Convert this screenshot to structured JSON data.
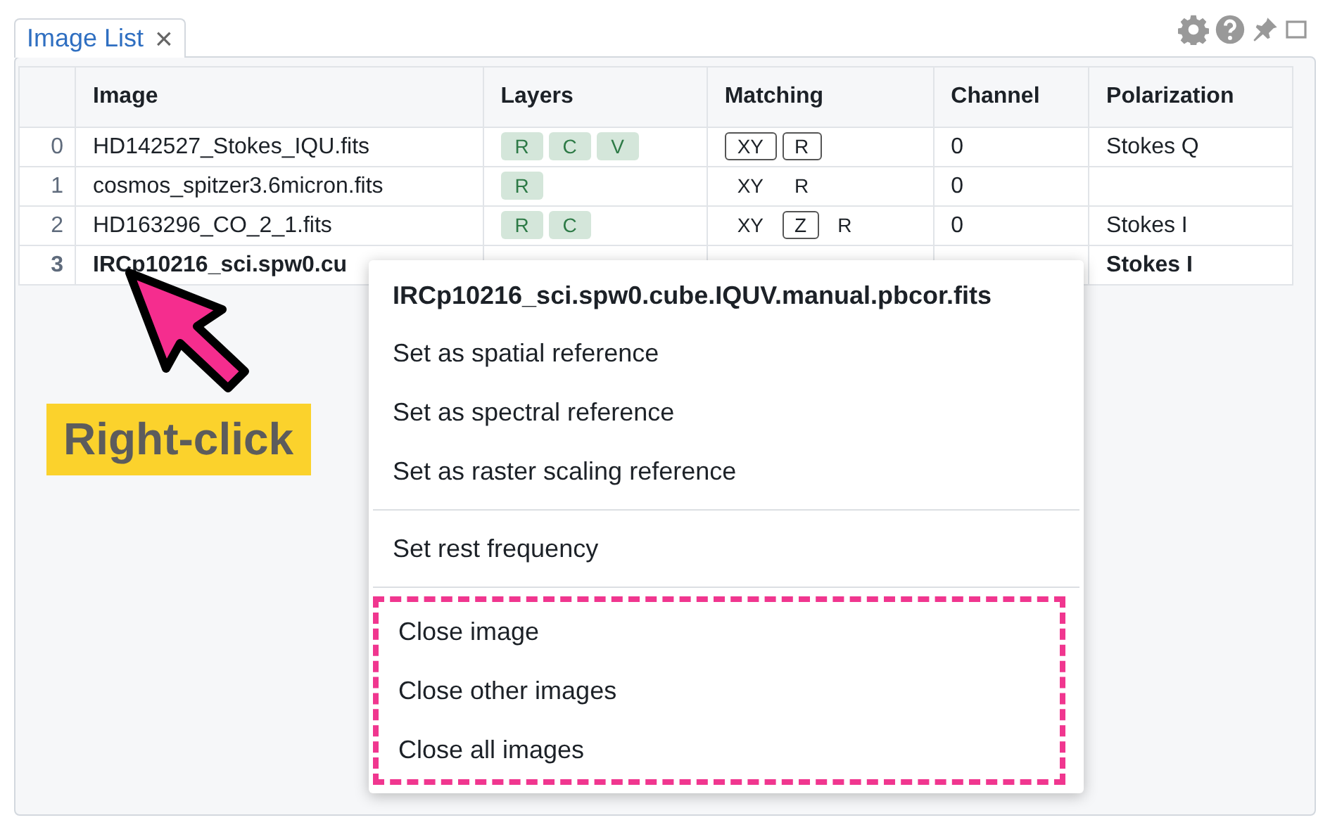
{
  "tab": {
    "label": "Image List",
    "close": "×",
    "selected": true
  },
  "columns": [
    "Image",
    "Layers",
    "Matching",
    "Channel",
    "Polarization"
  ],
  "rows": [
    {
      "index": "0",
      "image": "HD142527_Stokes_IQU.fits",
      "selected": false,
      "layers": [
        "R",
        "C",
        "V"
      ],
      "matching": [
        {
          "label": "XY",
          "on": true
        },
        {
          "label": "R",
          "on": true
        }
      ],
      "channel": "0",
      "polarization": "Stokes Q"
    },
    {
      "index": "1",
      "image": "cosmos_spitzer3.6micron.fits",
      "selected": false,
      "layers": [
        "R"
      ],
      "matching": [
        {
          "label": "XY",
          "on": false
        },
        {
          "label": "R",
          "on": false
        }
      ],
      "channel": "0"
    },
    {
      "index": "2",
      "image": "HD163296_CO_2_1.fits",
      "selected": false,
      "layers": [
        "R",
        "C"
      ],
      "matching": [
        {
          "label": "XY",
          "on": false
        },
        {
          "label": "Z",
          "on": true
        },
        {
          "label": "R",
          "on": false
        }
      ],
      "channel": "0",
      "polarization": "Stokes I"
    },
    {
      "index": "3",
      "image": "IRCp10216_sci.spw0.cu",
      "selected": true,
      "polarization": "Stokes I"
    }
  ],
  "context_menu": {
    "title": "IRCp10216_sci.spw0.cube.IQUV.manual.pbcor.fits",
    "groups": [
      {
        "highlighted": false,
        "items": [
          "Set as spatial reference",
          "Set as spectral reference",
          "Set as raster scaling reference"
        ]
      },
      {
        "highlighted": false,
        "items": [
          "Set rest frequency"
        ]
      },
      {
        "highlighted": true,
        "items": [
          "Close image",
          "Close other images",
          "Close all images"
        ]
      }
    ]
  },
  "callout": {
    "label": "Right-click"
  }
}
